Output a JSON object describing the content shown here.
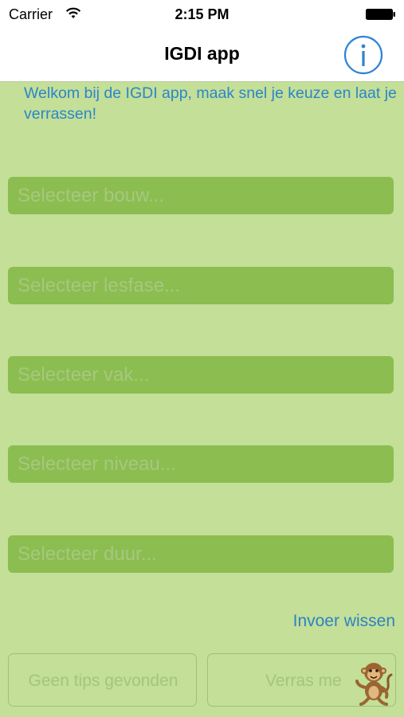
{
  "status_bar": {
    "carrier": "Carrier",
    "time": "2:15 PM"
  },
  "nav": {
    "title": "IGDI app",
    "info_icon": "info-icon"
  },
  "welcome_text": "Welkom bij de IGDI app, maak snel je keuze en laat je verrassen!",
  "fields": [
    {
      "placeholder": "Selecteer bouw..."
    },
    {
      "placeholder": "Selecteer lesfase..."
    },
    {
      "placeholder": "Selecteer vak..."
    },
    {
      "placeholder": "Selecteer niveau..."
    },
    {
      "placeholder": "Selecteer duur..."
    }
  ],
  "clear_label": "Invoer wissen",
  "buttons": {
    "no_tips": "Geen tips gevonden",
    "surprise": "Verras me"
  },
  "colors": {
    "background": "#c3df98",
    "field": "#8cbd50",
    "accent": "#2f82c3"
  }
}
